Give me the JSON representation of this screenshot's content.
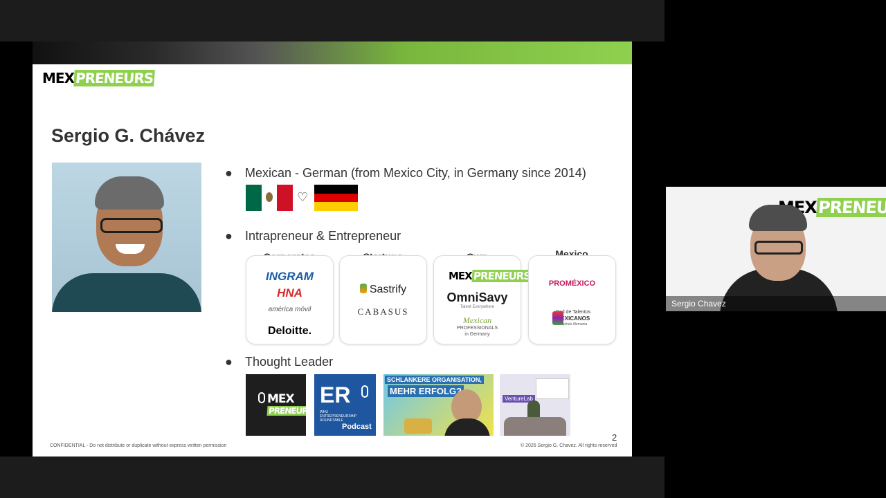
{
  "colors": {
    "brand_green": "#8fd14f",
    "mexico_green": "#006847",
    "mexico_red": "#ce1126",
    "germany_black": "#000000",
    "germany_red": "#dd0000",
    "germany_gold": "#ffce00"
  },
  "slide": {
    "logo": {
      "mex": "MEX",
      "preneurs": "PRENEURS"
    },
    "title": "Sergio G. Chávez",
    "bullets": {
      "b1": "Mexican - German (from Mexico City, in Germany since 2014)",
      "b2": "Intrapreneur & Entrepreneur",
      "b3": "Thought Leader",
      "dot": "●"
    },
    "heart": "♡",
    "cards": [
      {
        "title": "Corporates",
        "logos": [
          "INGRAM",
          "HNA",
          "américa móvil",
          "Deloitte."
        ]
      },
      {
        "title": "Startups",
        "logos": [
          "Sastrify",
          "CABASUS"
        ]
      },
      {
        "title": "Own",
        "logos": [
          "MEX",
          "PRENEURS",
          "OmniSavy",
          "Talent Everywhere",
          "Mexican",
          "PROFESSIONALS",
          "in Germany"
        ]
      },
      {
        "title": "Mexico",
        "logos": [
          "PROMÉXICO",
          "Red de Talentos",
          "MEXICANOS",
          "Capítulo Alemania"
        ]
      }
    ],
    "thumbs": {
      "t1": {
        "mex": "MEX",
        "pre": "PRENEURS"
      },
      "t2": {
        "er": "ER",
        "line1": "WHU",
        "line2": "ENTREPRENEURSHIP",
        "line3": "ROUNDTABLE",
        "podcast": "Podcast"
      },
      "t3": {
        "line1": "SCHLANKERE ORGANISATION,",
        "line2": "MEHR ERFOLG?"
      },
      "t4": {
        "venturelab": "VentureLab"
      }
    },
    "footer_left": "CONFIDENTIAL - Do not distribute or duplicate without express written permission",
    "footer_right": "© 2026 Sergio G. Chavez. All rights reserved",
    "page_number": "2"
  },
  "video": {
    "participant_name": "Sergio Chavez",
    "logo": {
      "mex": "MEX",
      "preneurs": "PRENEURS"
    }
  }
}
